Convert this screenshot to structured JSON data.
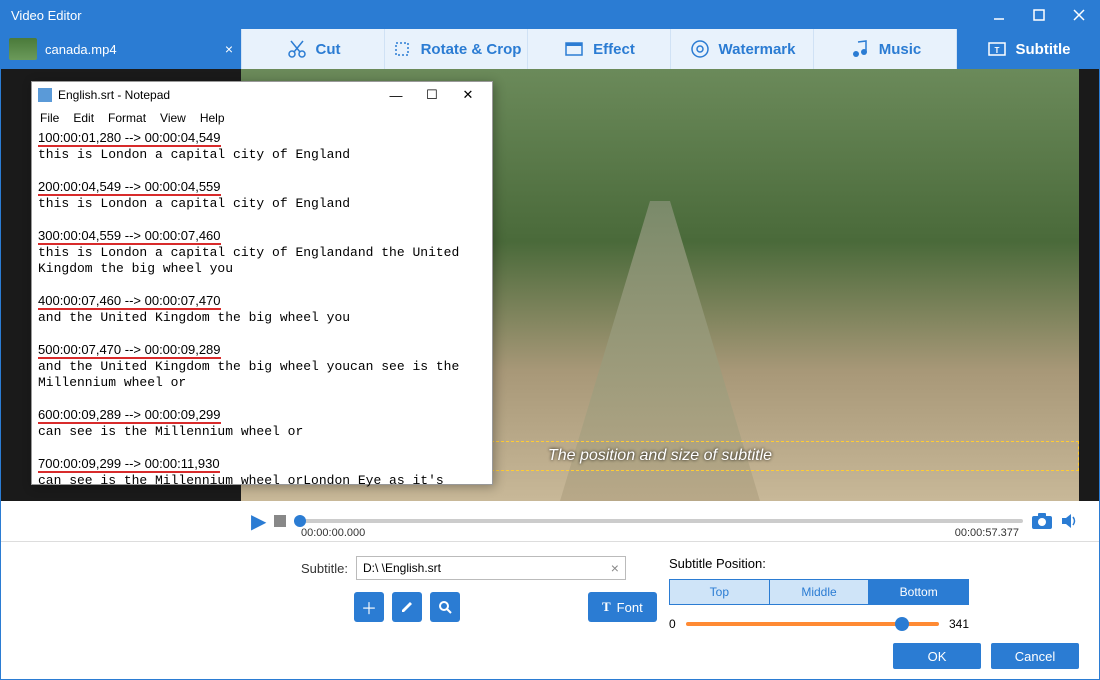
{
  "app": {
    "title": "Video Editor"
  },
  "file_tab": {
    "name": "canada.mp4"
  },
  "tools": {
    "cut": "Cut",
    "rotate": "Rotate & Crop",
    "effect": "Effect",
    "watermark": "Watermark",
    "music": "Music",
    "subtitle": "Subtitle"
  },
  "preview": {
    "subtitle_placeholder": "The position and size of subtitle"
  },
  "player": {
    "current_time": "00:00:00.000",
    "total_time": "00:00:57.377"
  },
  "subtitle_panel": {
    "label": "Subtitle:",
    "path": "D:\\             \\English.srt",
    "font_label": "Font"
  },
  "position_panel": {
    "label": "Subtitle Position:",
    "options": {
      "top": "Top",
      "middle": "Middle",
      "bottom": "Bottom"
    },
    "slider_min": "0",
    "slider_max": "341"
  },
  "footer": {
    "ok": "OK",
    "cancel": "Cancel"
  },
  "notepad": {
    "title": "English.srt - Notepad",
    "menu": {
      "file": "File",
      "edit": "Edit",
      "format": "Format",
      "view": "View",
      "help": "Help"
    },
    "entries": [
      {
        "tc": "100:00:01,280 --> 00:00:04,549",
        "text": "this is London a capital city of England"
      },
      {
        "tc": "200:00:04,549 --> 00:00:04,559",
        "text": "this is London a capital city of England"
      },
      {
        "tc": "300:00:04,559 --> 00:00:07,460",
        "text": "this is London a capital city of Englandand the United\nKingdom the big wheel you"
      },
      {
        "tc": "400:00:07,460 --> 00:00:07,470",
        "text": "and the United Kingdom the big wheel you"
      },
      {
        "tc": "500:00:07,470 --> 00:00:09,289",
        "text": "and the United Kingdom the big wheel youcan see is the\nMillennium wheel or"
      },
      {
        "tc": "600:00:09,289 --> 00:00:09,299",
        "text": "can see is the Millennium wheel or"
      },
      {
        "tc": "700:00:09,299 --> 00:00:11,930",
        "text": "can see is the Millennium wheel orLondon Eye as it's"
      }
    ]
  }
}
